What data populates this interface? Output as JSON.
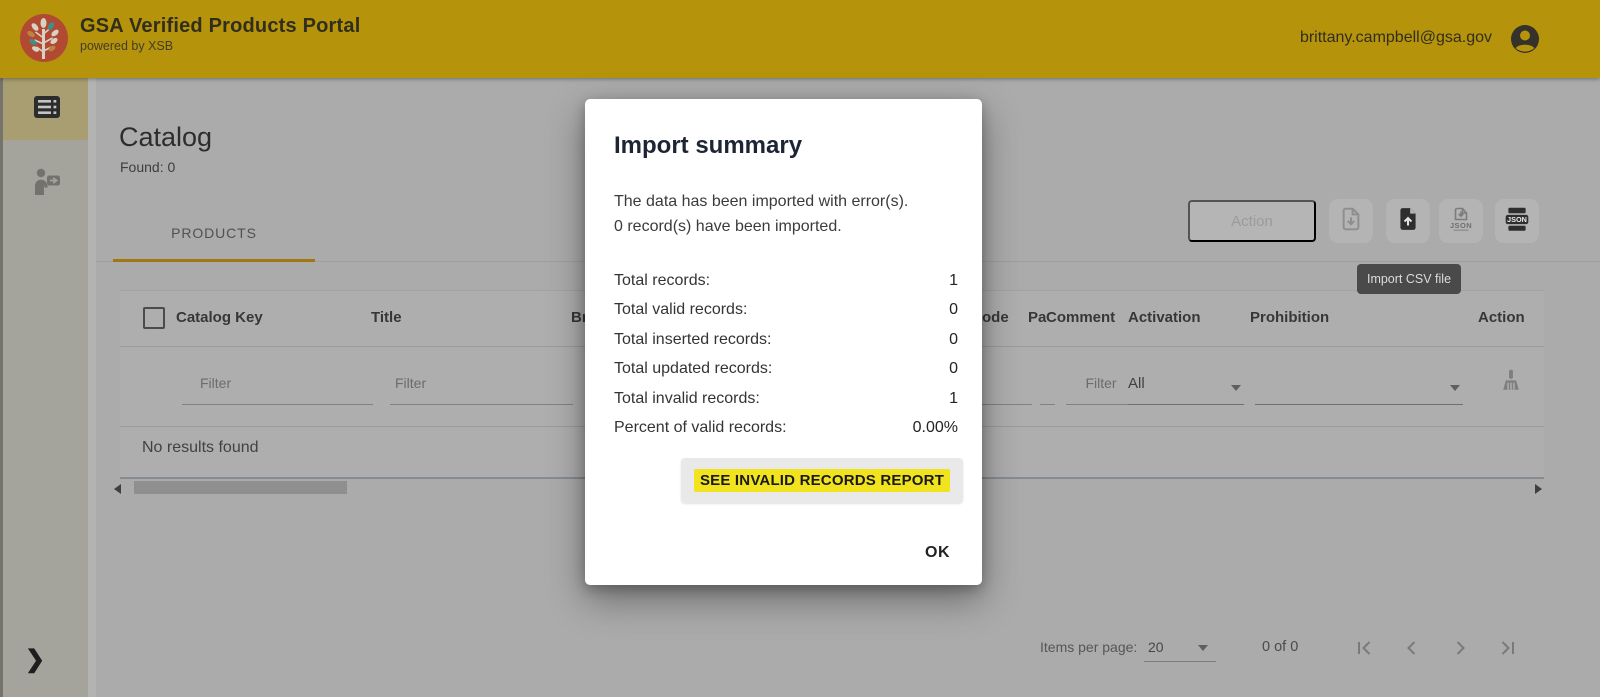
{
  "colors": {
    "header_gold": "#B5930B",
    "accent_gold": "#A27712",
    "logo_red": "#B24A33",
    "highlight_yellow": "#F1E41F",
    "tooltip_bg": "#4A4A4A",
    "modal_bg": "#FFFFFF"
  },
  "header": {
    "title": "GSA Verified Products Portal",
    "subtitle": "powered by XSB",
    "user_email": "brittany.campbell@gsa.gov",
    "account_icon": "account-circle-icon"
  },
  "sidebar": {
    "catalog_icon": "table-list-icon",
    "suppliers_icon": "person-arrow-icon",
    "expand_icon": "❯"
  },
  "page": {
    "title": "Catalog",
    "found": "Found: 0",
    "tab_products": "PRODUCTS"
  },
  "toolbar": {
    "action": "Action",
    "download_csv_icon": "file-download-icon",
    "import_csv_icon": "file-upload-icon",
    "export_json_icon": "file-download-json-icon",
    "import_json_icon": "json-printer-icon",
    "tooltip_import_csv": "Import CSV file"
  },
  "table": {
    "columns": [
      "Catalog Key",
      "Title",
      "Br",
      "ode",
      "Pa",
      "Comment",
      "Activation",
      "Prohibition",
      "Action"
    ],
    "filter_placeholder": "Filter",
    "activation_filter": "All",
    "clear_filters_icon": "broom-icon",
    "empty": "No results found"
  },
  "pagination": {
    "items_per_page_label": "Items per page:",
    "page_size": "20",
    "range": "0 of 0"
  },
  "modal": {
    "title": "Import summary",
    "message_line1": "The data has been imported with error(s).",
    "message_line2": "0 record(s) have been imported.",
    "stats": [
      {
        "label": "Total records:",
        "value": "1"
      },
      {
        "label": "Total valid records:",
        "value": "0"
      },
      {
        "label": "Total inserted records:",
        "value": "0"
      },
      {
        "label": "Total updated records:",
        "value": "0"
      },
      {
        "label": "Total invalid records:",
        "value": "1"
      },
      {
        "label": "Percent of valid records:",
        "value": "0.00%"
      }
    ],
    "report_button": "SEE INVALID RECORDS REPORT",
    "ok_button": "OK"
  }
}
